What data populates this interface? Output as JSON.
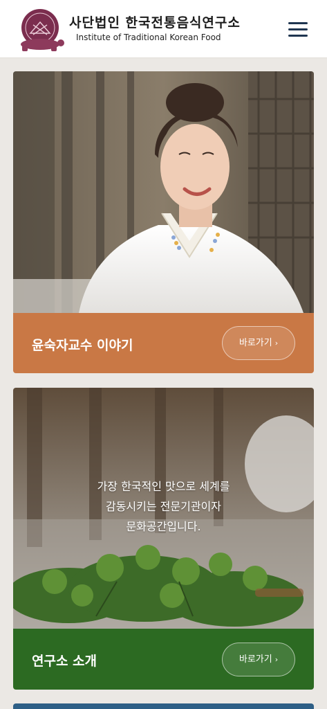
{
  "header": {
    "brand_korean": "사단법인 한국전통음식연구소",
    "brand_english": "Institute of Traditional Korean Food",
    "logo_icon": "turtle-logo-icon",
    "logo_color": "#7b2d4e",
    "menu_icon": "hamburger-menu-icon"
  },
  "cards": [
    {
      "title": "윤숙자교수 이야기",
      "button_label": "바로가기",
      "button_icon": "chevron-right-icon",
      "bar_color": "#c97845"
    },
    {
      "title": "연구소 소개",
      "overlay_lines": [
        "가장 한국적인 맛으로 세계를",
        "감동시키는 전문기관이자",
        "문화공간입니다."
      ],
      "button_label": "바로가기",
      "button_icon": "chevron-right-icon",
      "bar_color": "#2c6a22"
    }
  ]
}
